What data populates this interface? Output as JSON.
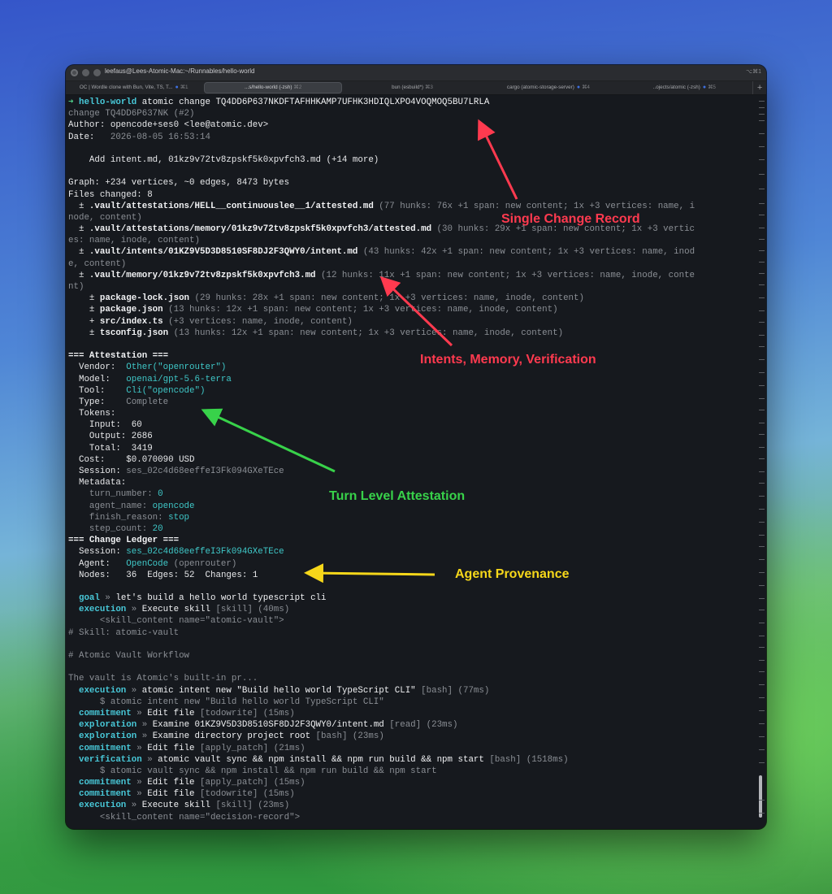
{
  "window": {
    "title": "leefaus@Lees-Atomic-Mac:~/Runnables/hello-world",
    "title_shortcut": "⌥⌘1"
  },
  "tabs": [
    {
      "label": "OC | Wordle clone with Bun, Vite, TS, T...",
      "shortcut": "⌘1",
      "dot": true
    },
    {
      "label": "...s/hello-world (-zsh)",
      "shortcut": "⌘2",
      "dot": false,
      "active": true
    },
    {
      "label": "bun (esbuild*)",
      "shortcut": "⌘3",
      "dot": false
    },
    {
      "label": "cargo (atomic-storage-server)",
      "shortcut": "⌘4",
      "dot": true
    },
    {
      "label": "..ojects/atomic (-zsh)",
      "shortcut": "⌘5",
      "dot": true
    }
  ],
  "new_tab_label": "+",
  "terminal": {
    "prompt_arrow": "➜",
    "prompt_dir": "hello-world",
    "command": "atomic change TQ4DD6P637NKDFTAFHHKAMP7UFHK3HDIQLXPO4VOQMOQ5BU7LRLA",
    "change_line": "change TQ4DD6P637NK (#2)",
    "author": "opencode+ses0 <lee@atomic.dev>",
    "date": "2026-08-05 16:53:14",
    "message": "Add intent.md, 01kz9v72tv8zpskf5k0xpvfch3.md (+14 more)",
    "graph": "Graph: +234 vertices, ~0 edges, 8473 bytes",
    "files_changed": "Files changed: 8",
    "files": [
      {
        "path": ".vault/attestations/HELL__continuouslee__1/attested.md",
        "detail": "(77 hunks: 76x +1 span: new content; 1x +3 vertices: name, i",
        "wrap": "node, content)",
        "indent": "  "
      },
      {
        "path": ".vault/attestations/memory/01kz9v72tv8zpskf5k0xpvfch3/attested.md",
        "detail": "(30 hunks: 29x +1 span: new content; 1x +3 vertic",
        "wrap": "es: name, inode, content)",
        "indent": "  "
      },
      {
        "path": ".vault/intents/01KZ9V5D3D8510SF8DJ2F3QWY0/intent.md",
        "detail": "(43 hunks: 42x +1 span: new content; 1x +3 vertices: name, inod",
        "wrap": "e, content)",
        "indent": "  "
      },
      {
        "path": ".vault/memory/01kz9v72tv8zpskf5k0xpvfch3.md",
        "detail": "(12 hunks: 11x +1 span: new content; 1x +3 vertices: name, inode, conte",
        "wrap": "nt)",
        "indent": "  "
      },
      {
        "path": "package-lock.json",
        "detail": "(29 hunks: 28x +1 span: new content; 1x +3 vertices: name, inode, content)",
        "indent": "    "
      },
      {
        "path": "package.json",
        "detail": "(13 hunks: 12x +1 span: new content; 1x +3 vertices: name, inode, content)",
        "indent": "    "
      },
      {
        "path": "src/index.ts",
        "detail": "(+3 vertices: name, inode, content)",
        "indent": "    ",
        "marker": "+"
      },
      {
        "path": "tsconfig.json",
        "detail": "(13 hunks: 12x +1 span: new content; 1x +3 vertices: name, inode, content)",
        "indent": "    "
      }
    ],
    "attestation": {
      "header": "=== Attestation ===",
      "vendor": "Other(\"openrouter\")",
      "model": "openai/gpt-5.6-terra",
      "tool": "Cli(\"opencode\")",
      "type": "Complete",
      "input": "60",
      "output": "2686",
      "total": "3419",
      "cost": "$0.070090 USD",
      "session": "ses_02c4d68eeffeI3Fk094GXeTEce",
      "turn_number": "0",
      "agent_name": "opencode",
      "finish_reason": "stop",
      "step_count": "20"
    },
    "ledger": {
      "header": "=== Change Ledger ===",
      "session": "ses_02c4d68eeffeI3Fk094GXeTEce",
      "agent": "OpenCode",
      "agent_vendor": "(openrouter)",
      "nodes": "36",
      "edges": "52",
      "changes": "1"
    },
    "events": [
      {
        "kind": "goal",
        "text": "let's build a hello world typescript cli",
        "tag": "",
        "ms": ""
      },
      {
        "kind": "execution",
        "text": "Execute skill",
        "tag": "[skill]",
        "ms": "(40ms)"
      },
      {
        "raw": "      <skill_content name=\"atomic-vault\">",
        "cls": "d"
      },
      {
        "raw": "# Skill: atomic-vault",
        "cls": "d"
      },
      {
        "raw": "",
        "cls": "d"
      },
      {
        "raw": "# Atomic Vault Workflow",
        "cls": "d"
      },
      {
        "raw": "",
        "cls": "d"
      },
      {
        "raw": "The vault is Atomic's built-in pr...",
        "cls": "d"
      },
      {
        "kind": "execution",
        "text": "atomic intent new \"Build hello world TypeScript CLI\"",
        "tag": "[bash]",
        "ms": "(77ms)"
      },
      {
        "raw": "      $ atomic intent new \"Build hello world TypeScript CLI\"",
        "cls": "d"
      },
      {
        "kind": "commitment",
        "text": "Edit file",
        "tag": "[todowrite]",
        "ms": "(15ms)"
      },
      {
        "kind": "exploration",
        "text": "Examine 01KZ9V5D3D8510SF8DJ2F3QWY0/intent.md",
        "tag": "[read]",
        "ms": "(23ms)"
      },
      {
        "kind": "exploration",
        "text": "Examine directory project root",
        "tag": "[bash]",
        "ms": "(23ms)"
      },
      {
        "kind": "commitment",
        "text": "Edit file",
        "tag": "[apply_patch]",
        "ms": "(21ms)"
      },
      {
        "kind": "verification",
        "text": "atomic vault sync && npm install && npm run build && npm start",
        "tag": "[bash]",
        "ms": "(1518ms)"
      },
      {
        "raw": "      $ atomic vault sync && npm install && npm run build && npm start",
        "cls": "d"
      },
      {
        "kind": "commitment",
        "text": "Edit file",
        "tag": "[apply_patch]",
        "ms": "(15ms)"
      },
      {
        "kind": "commitment",
        "text": "Edit file",
        "tag": "[todowrite]",
        "ms": "(15ms)"
      },
      {
        "kind": "execution",
        "text": "Execute skill",
        "tag": "[skill]",
        "ms": "(23ms)"
      },
      {
        "raw": "      <skill_content name=\"decision-record\">",
        "cls": "d"
      }
    ]
  },
  "annotations": {
    "single_change": "Single Change Record",
    "intents": "Intents, Memory, Verification",
    "turn_level": "Turn Level Attestation",
    "agent_provenance": "Agent Provenance",
    "colors": {
      "red": "#ff3a4f",
      "green": "#38d24a",
      "yellow": "#f6d71a"
    }
  }
}
